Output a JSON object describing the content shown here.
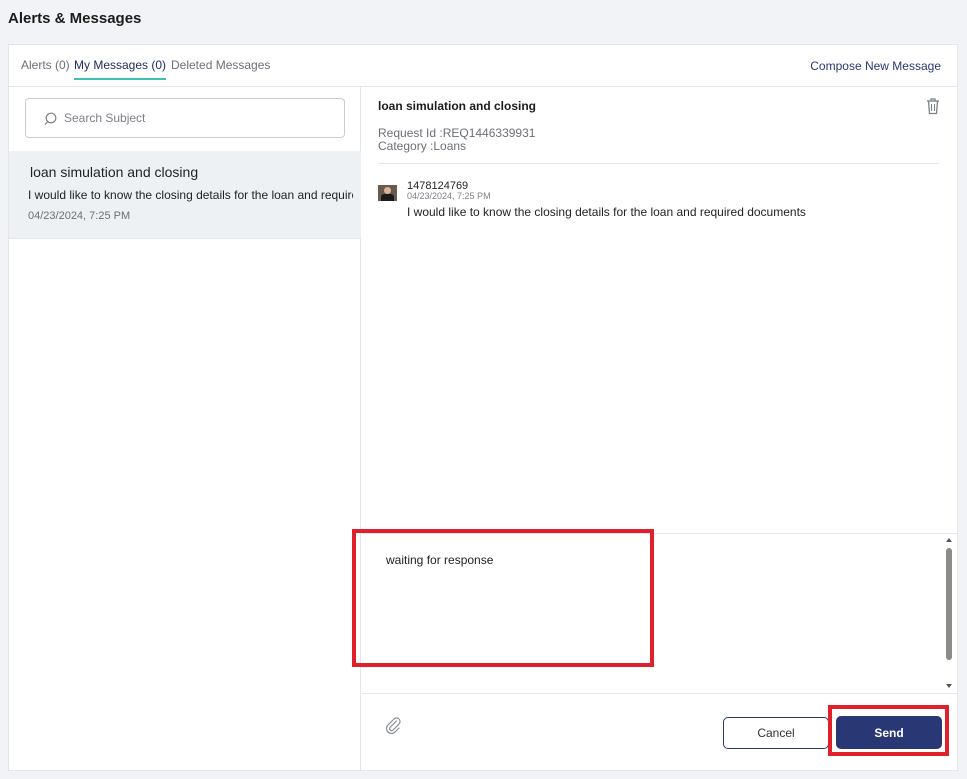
{
  "page": {
    "title": "Alerts & Messages"
  },
  "tabs": [
    {
      "label": "Alerts (0)"
    },
    {
      "label": "My Messages (0)"
    },
    {
      "label": "Deleted Messages"
    }
  ],
  "compose_label": "Compose New Message",
  "search": {
    "placeholder": "Search Subject"
  },
  "message_list": [
    {
      "subject": "loan simulation and closing",
      "preview": "I would like to know the closing details for the loan and required documents",
      "date": "04/23/2024, 7:25 PM"
    }
  ],
  "detail": {
    "subject": "loan simulation and closing",
    "request_id": "Request Id :REQ1446339931",
    "category": "Category :Loans",
    "sender_id": "1478124769",
    "sent_date": "04/23/2024, 7:25 PM",
    "body": "I would like to know the closing details for the loan and required documents"
  },
  "reply": {
    "value": "waiting for response"
  },
  "buttons": {
    "cancel": "Cancel",
    "send": "Send"
  },
  "colors": {
    "accent": "#2a3775",
    "tab_underline": "#3ec1b5",
    "highlight": "#e0202a"
  },
  "icons": [
    "search-icon",
    "trash-icon",
    "paperclip-icon"
  ]
}
